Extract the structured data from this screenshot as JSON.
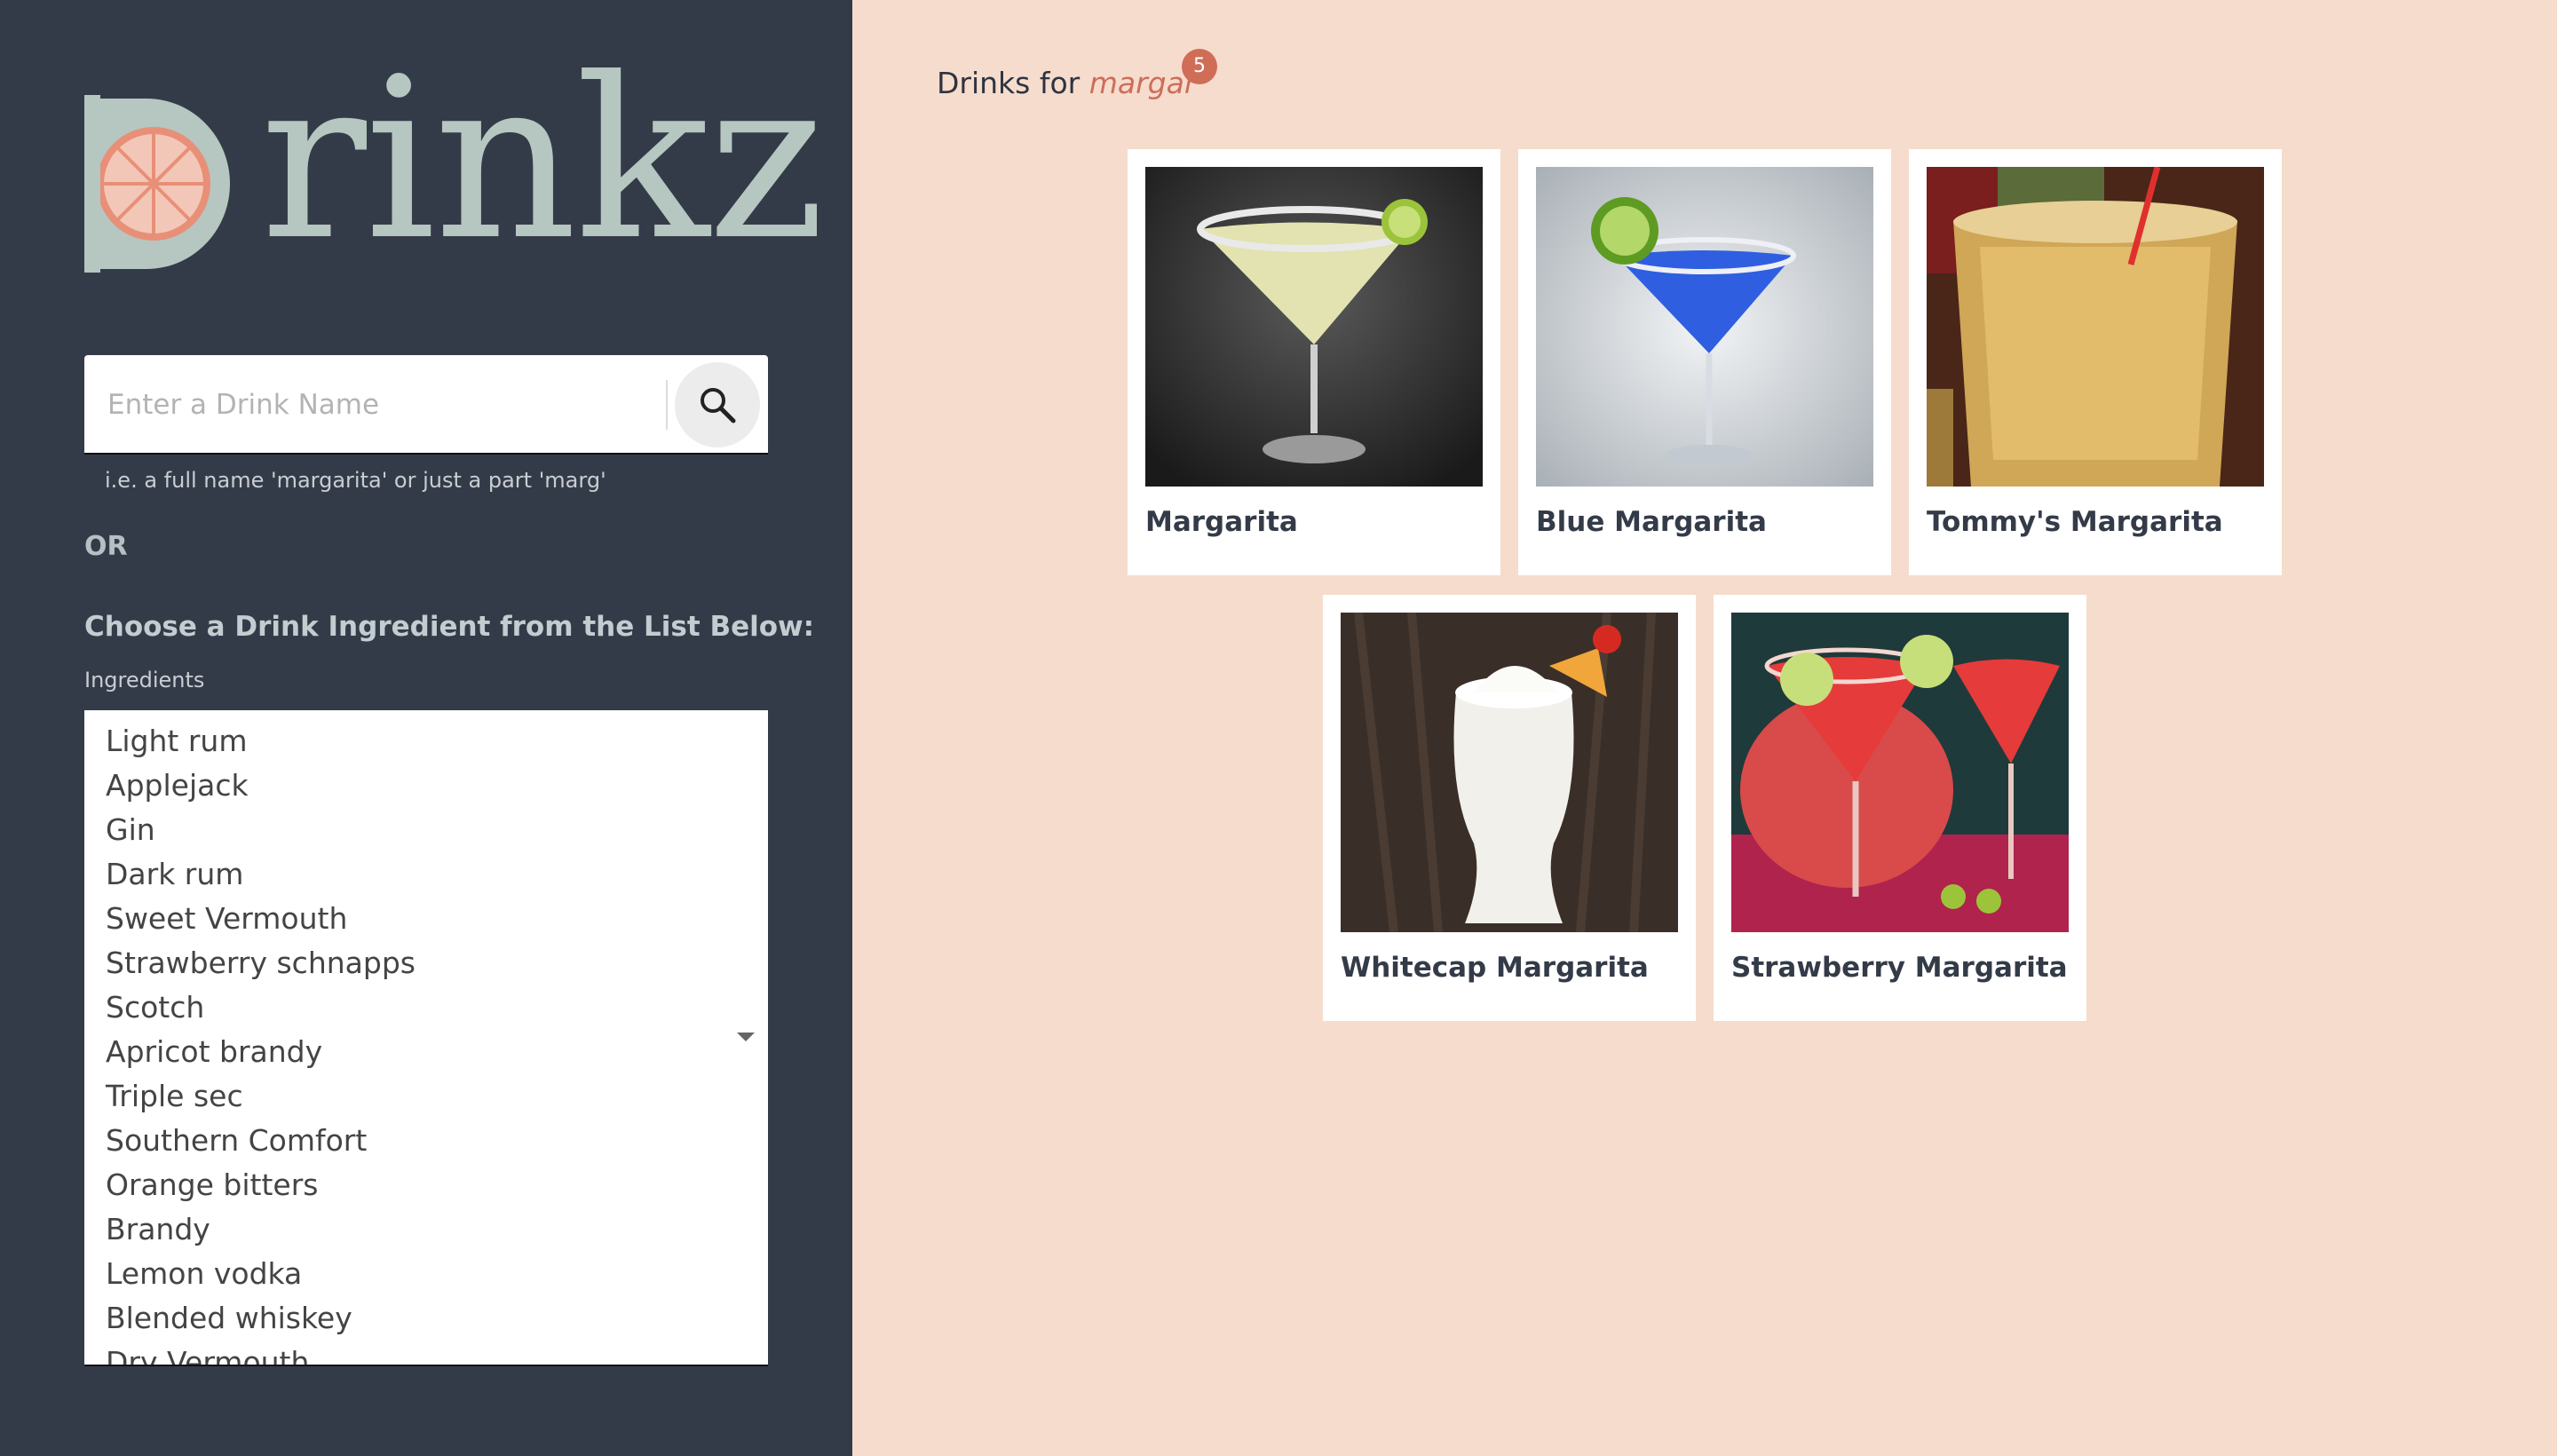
{
  "brand": {
    "name": "Drinkz"
  },
  "search": {
    "placeholder": "Enter a Drink Name",
    "hint": "i.e. a full name 'margarita' or just a part 'marg'"
  },
  "or_label": "OR",
  "ingredient_section": {
    "heading": "Choose a Drink Ingredient from the List Below:",
    "label": "Ingredients",
    "options": [
      "Light rum",
      "Applejack",
      "Gin",
      "Dark rum",
      "Sweet Vermouth",
      "Strawberry schnapps",
      "Scotch",
      "Apricot brandy",
      "Triple sec",
      "Southern Comfort",
      "Orange bitters",
      "Brandy",
      "Lemon vodka",
      "Blended whiskey",
      "Dry Vermouth"
    ]
  },
  "results": {
    "prefix": "Drinks for",
    "query": "margar",
    "count": "5",
    "drinks": [
      {
        "name": "Margarita"
      },
      {
        "name": "Blue Margarita"
      },
      {
        "name": "Tommy's Margarita"
      },
      {
        "name": "Whitecap Margarita"
      },
      {
        "name": "Strawberry Margarita"
      }
    ]
  },
  "colors": {
    "sidebar": "#343b48",
    "page": "#f6dccd",
    "accent": "#cf6d57",
    "logo": "#b6c6c0"
  }
}
